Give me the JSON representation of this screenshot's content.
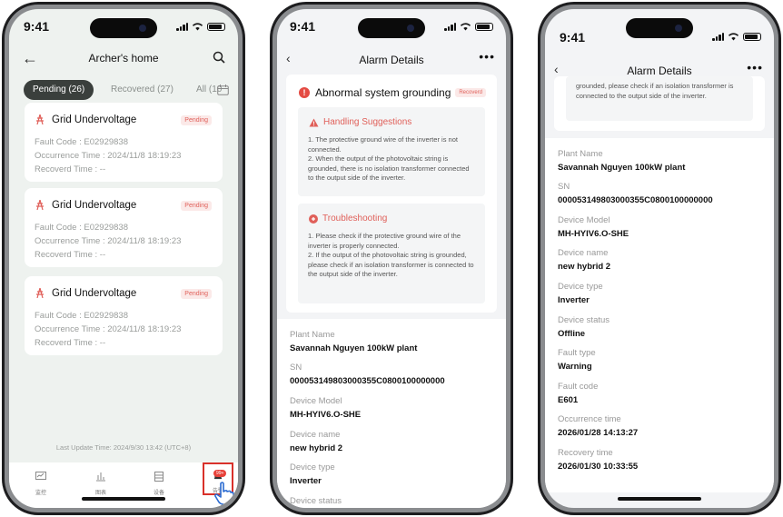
{
  "status_time": "9:41",
  "phone1": {
    "title": "Archer's home",
    "tabs": {
      "pending": "Pending (26)",
      "recovered": "Recovered (27)",
      "all": "All (10"
    },
    "alarms": [
      {
        "title": "Grid Undervoltage",
        "badge": "Pending",
        "fault_code": "Fault Code : E02929838",
        "occurrence": "Occurrence Time : 2024/11/8 18:19:23",
        "recovered": "Recoverd Time : --"
      },
      {
        "title": "Grid Undervoltage",
        "badge": "Pending",
        "fault_code": "Fault Code : E02929838",
        "occurrence": "Occurrence Time : 2024/11/8 18:19:23",
        "recovered": "Recoverd Time : --"
      },
      {
        "title": "Grid Undervoltage",
        "badge": "Pending",
        "fault_code": "Fault Code : E02929838",
        "occurrence": "Occurrence Time : 2024/11/8 18:19:23",
        "recovered": "Recoverd Time : --"
      }
    ],
    "last_update": "Last Update Time: 2024/9/30 13:42 (UTC+8)",
    "tabbar": [
      "监控",
      "图表",
      "设备",
      "告警"
    ],
    "alarm_badge": "99+"
  },
  "phone2": {
    "nav_title": "Alarm Details",
    "alarm_title": "Abnormal system grounding",
    "alarm_badge": "Recoverd",
    "handling_title": "Handling Suggestions",
    "handling_body": "1. The protective ground wire of the inverter is not connected.\n2. When the output of the photovoltaic string is grounded, there is no isolation transformer connected to the output side of the inverter.",
    "trouble_title": "Troubleshooting",
    "trouble_body": "1. Please check if the protective ground wire of the inverter is properly connected.\n2. If the output of the photovoltaic string is grounded, please check if an isolation transformer is connected to the output side of the inverter.",
    "info": [
      {
        "k": "Plant Name",
        "v": "Savannah Nguyen 100kW plant"
      },
      {
        "k": "SN",
        "v": "00005314980300035 5C0800100000000"
      },
      {
        "k": "Device Model",
        "v": "MH-HYIV6.O-SHE"
      },
      {
        "k": "Device name",
        "v": "new hybrid 2"
      },
      {
        "k": "Device type",
        "v": "Inverter"
      },
      {
        "k": "Device status",
        "v": ""
      }
    ]
  },
  "phone3": {
    "nav_title": "Alarm Details",
    "scroll_text": "grounded, please check if an isolation transformer is connected to the output side of the inverter.",
    "info": [
      {
        "k": "Plant Name",
        "v": "Savannah Nguyen 100kW plant"
      },
      {
        "k": "SN",
        "v": "000053149803000355C0800100000000"
      },
      {
        "k": "Device Model",
        "v": "MH-HYIV6.O-SHE"
      },
      {
        "k": "Device name",
        "v": "new hybrid 2"
      },
      {
        "k": "Device type",
        "v": "Inverter"
      },
      {
        "k": "Device status",
        "v": "Offline"
      },
      {
        "k": "Fault type",
        "v": "Warning"
      },
      {
        "k": "Fault code",
        "v": "E601"
      },
      {
        "k": "Occurrence time",
        "v": "2026/01/28 14:13:27"
      },
      {
        "k": "Recovery time",
        "v": "2026/01/30 10:33:55"
      }
    ]
  }
}
